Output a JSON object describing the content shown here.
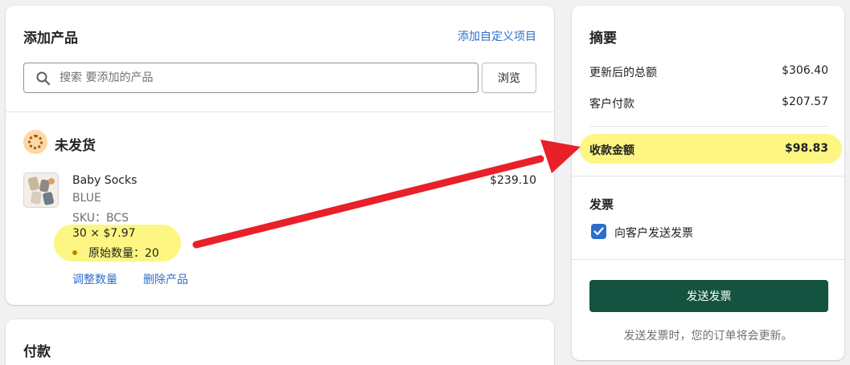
{
  "products_card": {
    "title": "添加产品",
    "custom_item_link": "添加自定义项目",
    "search": {
      "placeholder": "搜索 要添加的产品",
      "value": ""
    },
    "browse_label": "浏览",
    "fulfillment_status": "未发货",
    "line_item": {
      "name": "Baby Socks",
      "variant": "BLUE",
      "sku": "SKU：BCS",
      "quantity_price": "30 × $7.97",
      "original_quantity": "原始数量：20",
      "total": "$239.10",
      "adjust_link": "调整数量",
      "remove_link": "删除产品"
    }
  },
  "payment_card": {
    "title": "付款"
  },
  "summary": {
    "title": "摘要",
    "rows": [
      {
        "label": "更新后的总额",
        "value": "$306.40"
      },
      {
        "label": "客户付款",
        "value": "$207.57"
      }
    ],
    "amount_due": {
      "label": "收款金额",
      "value": "$98.83"
    },
    "invoice": {
      "title": "发票",
      "checkbox_label": "向客户发送发票",
      "checked": true
    },
    "send_button": "发送发票",
    "note": "发送发票时，您的订单将会更新。"
  },
  "colors": {
    "highlight": "#fdf683",
    "arrow": "#e8202a",
    "primary_button": "#14533f",
    "link": "#2c6ecb",
    "checkbox": "#2c6ecb"
  }
}
